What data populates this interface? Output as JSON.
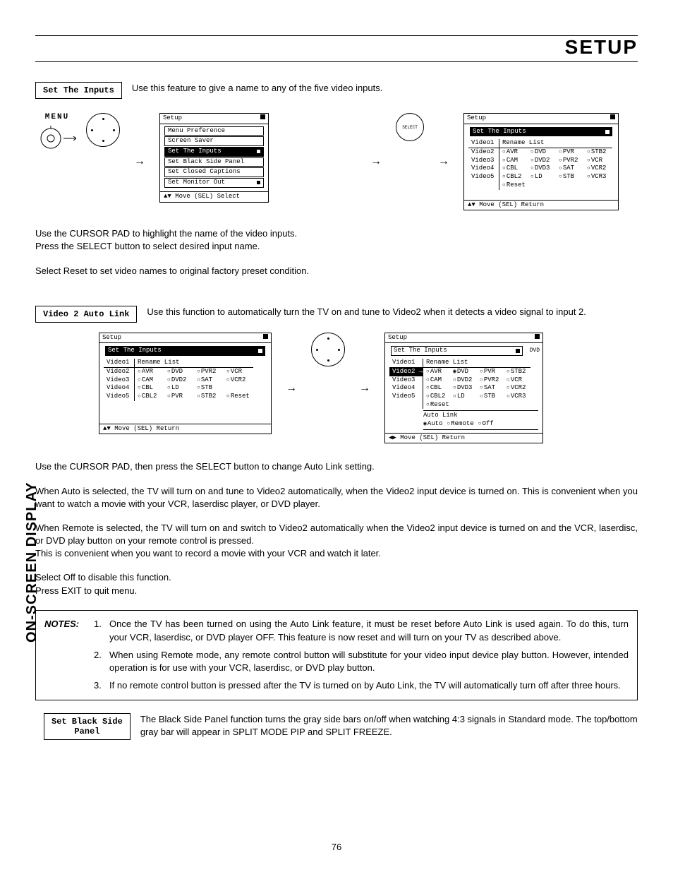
{
  "header": {
    "title": "SETUP"
  },
  "side_label": "ON-SCREEN DISPLAY",
  "page_number": "76",
  "section1": {
    "title": "Set The Inputs",
    "desc": "Use this feature to give a name to any of the five video inputs."
  },
  "remote": {
    "menu_label": "MENU",
    "select_label": "SELECT"
  },
  "osd_a": {
    "title": "Setup",
    "items": [
      "Menu Preference",
      "Screen Saver",
      "Set The Inputs",
      "Set Black Side Panel",
      "Set Closed Captions",
      "Set Monitor Out"
    ],
    "selected_index": 2,
    "footer": "▲▼ Move  (SEL)  Select"
  },
  "osd_b": {
    "title": "Setup",
    "subtitle": "Set The Inputs",
    "rows": [
      "Video1",
      "Video2",
      "Video3",
      "Video4",
      "Video5"
    ],
    "row0_label": "Rename List",
    "grid": [
      [
        "AVR",
        "DVD",
        "PVR",
        "STB2"
      ],
      [
        "CAM",
        "DVD2",
        "PVR2",
        "VCR"
      ],
      [
        "CBL",
        "DVD3",
        "SAT",
        "VCR2"
      ],
      [
        "CBL2",
        "LD",
        "STB",
        "VCR3"
      ]
    ],
    "reset": "Reset",
    "footer": "▲▼ Move  (SEL)  Return"
  },
  "body1": {
    "p1": "Use the CURSOR PAD to highlight the name of the video inputs.",
    "p2": "Press the SELECT button to select desired input name.",
    "p3": "Select Reset to set video names to original factory preset condition."
  },
  "section2": {
    "title": "Video 2 Auto Link",
    "desc": "Use this function to automatically turn the TV on and tune to Video2 when it detects a video signal to input 2."
  },
  "osd_c": {
    "title": "Setup",
    "subtitle": "Set The Inputs",
    "rows": [
      "Video1",
      "Video2",
      "Video3",
      "Video4",
      "Video5"
    ],
    "row0_label": "Rename List",
    "grid": [
      [
        "AVR",
        "DVD",
        "PVR2",
        "VCR"
      ],
      [
        "CAM",
        "DVD2",
        "SAT",
        "VCR2"
      ],
      [
        "CBL",
        "LD",
        "STB",
        ""
      ],
      [
        "CBL2",
        "PVR",
        "STB2",
        "Reset"
      ]
    ],
    "footer": "▲▼ Move  (SEL)  Return"
  },
  "osd_d": {
    "title": "Setup",
    "subtitle": "Set The Inputs",
    "badge": "DVD",
    "rows": [
      "Video1",
      "Video2",
      "Video3",
      "Video4",
      "Video5"
    ],
    "row0_label": "Rename List",
    "selected_row": 1,
    "grid": [
      [
        "AVR",
        "DVD",
        "PVR",
        "STB2"
      ],
      [
        "CAM",
        "DVD2",
        "PVR2",
        "VCR"
      ],
      [
        "CBL",
        "DVD3",
        "SAT",
        "VCR2"
      ],
      [
        "CBL2",
        "LD",
        "STB",
        "VCR3"
      ]
    ],
    "selected_cell": [
      0,
      1
    ],
    "reset": "Reset",
    "autolink_label": "Auto Link",
    "autolink_opts": [
      "Auto",
      "Remote",
      "Off"
    ],
    "autolink_selected": 0,
    "footer": "◀▶ Move  (SEL)  Return"
  },
  "body2": {
    "p1": "Use the CURSOR PAD, then press the SELECT button to change Auto Link setting.",
    "p2": "When Auto is selected, the TV will turn on and tune to Video2 automatically, when the Video2 input device is turned on. This is convenient when you want to watch a movie with your VCR, laserdisc player, or DVD player.",
    "p3": "When Remote is selected, the TV will turn on and switch to Video2 automatically when the Video2 input device is turned on and the VCR, laserdisc, or DVD play button on your remote control is pressed.",
    "p4": "This is convenient when you want to record a movie with your VCR and watch it later.",
    "p5": "Select Off to disable this function.",
    "p6": "Press EXIT to quit menu."
  },
  "notes": {
    "label": "NOTES:",
    "items": [
      "Once the TV has been turned on using the Auto Link feature, it must be reset before Auto Link is used again. To do this, turn your VCR, laserdisc, or DVD player OFF. This feature is now reset and will turn on your TV as described above.",
      "When using Remote mode, any remote control button will substitute for your video input device play button. However, intended operation is for use with your VCR, laserdisc, or DVD play button.",
      "If no remote control button is pressed after the TV is turned on by Auto Link, the TV will automatically turn off after three hours."
    ]
  },
  "section3": {
    "title": "Set Black Side\nPanel",
    "desc": "The Black Side Panel function turns the gray side bars on/off when watching 4:3 signals in Standard mode.  The top/bottom gray bar will appear in SPLIT MODE PIP and SPLIT FREEZE."
  }
}
